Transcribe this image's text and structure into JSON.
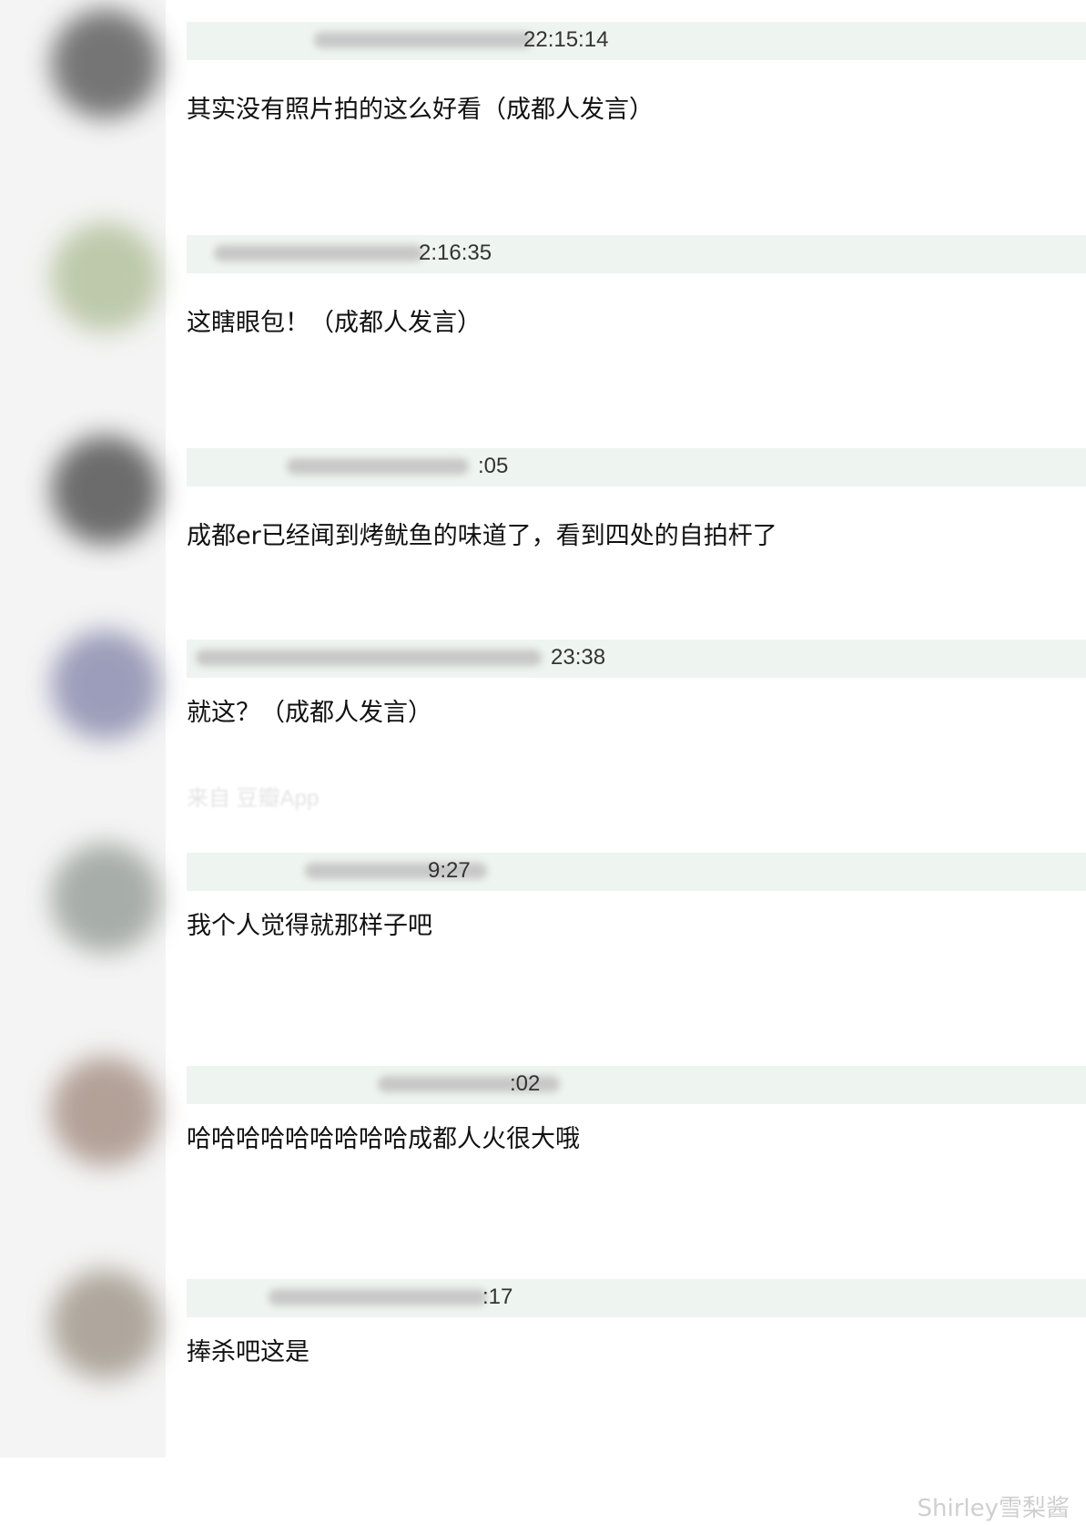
{
  "comments": [
    {
      "timestamp": "22:15:14",
      "content": "其实没有照片拍的这么好看（成都人发言）",
      "avatar_color": "#606060",
      "source": ""
    },
    {
      "timestamp": "2:16:35",
      "content": "这瞎眼包！（成都人发言）",
      "avatar_color": "#b4c29e",
      "source": ""
    },
    {
      "timestamp": ":05",
      "content": "成都er已经闻到烤鱿鱼的味道了，看到四处的自拍杆了",
      "avatar_color": "#555555",
      "source": ""
    },
    {
      "timestamp": "23:38",
      "content": "就这？（成都人发言）",
      "avatar_color": "#8d8fb0",
      "source": ""
    },
    {
      "timestamp": "9:27",
      "content": "我个人觉得就那样子吧",
      "avatar_color": "#9aa19b",
      "source": "来自 豆瓣App"
    },
    {
      "timestamp": ":02",
      "content": "哈哈哈哈哈哈哈哈哈成都人火很大哦",
      "avatar_color": "#a89388",
      "source": ""
    },
    {
      "timestamp": ":17",
      "content": "捧杀吧这是",
      "avatar_color": "#a39a8e",
      "source": ""
    }
  ],
  "watermark": "Shirley雪梨酱"
}
